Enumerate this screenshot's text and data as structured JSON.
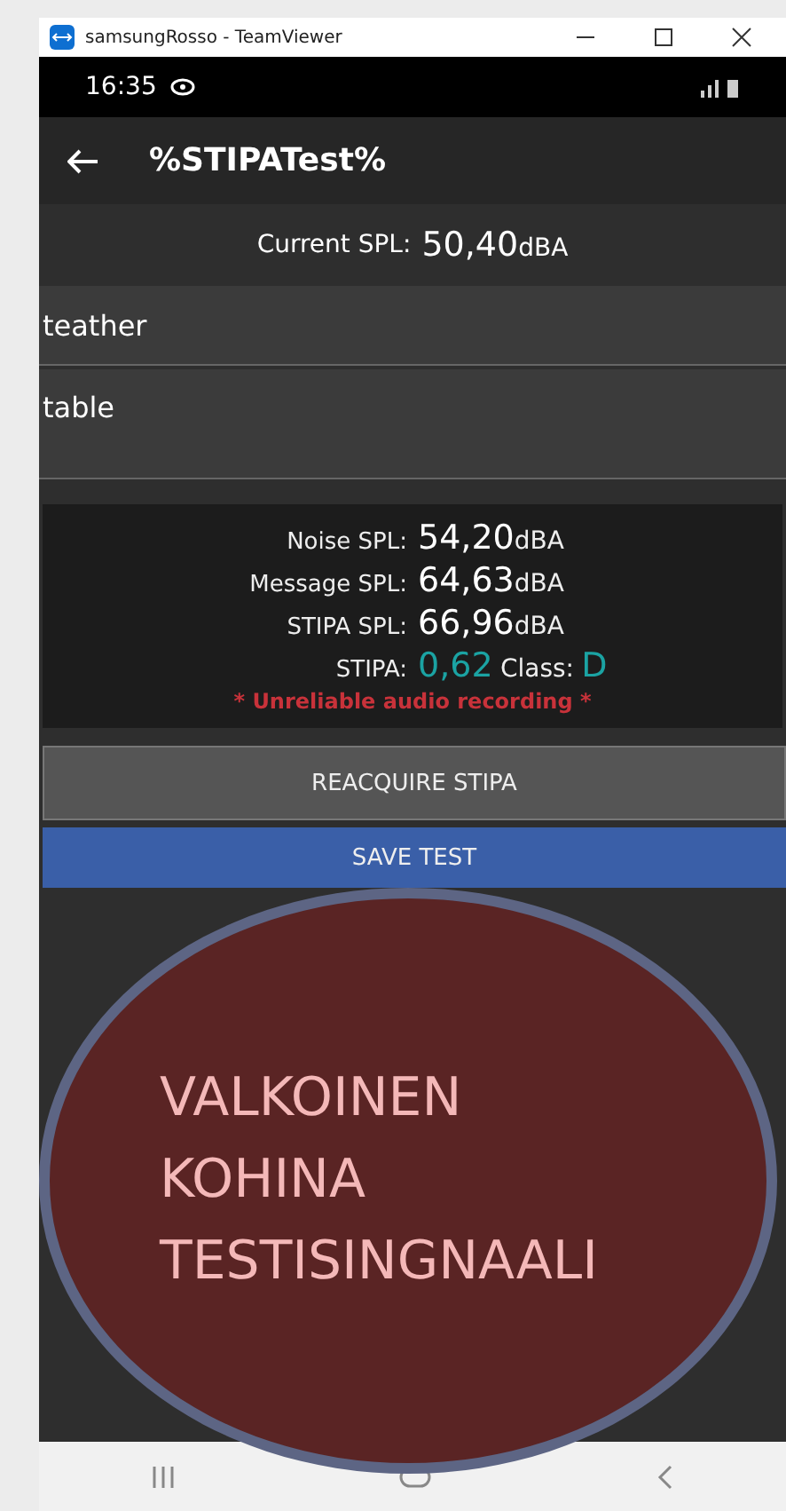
{
  "window": {
    "title": "samsungRosso - TeamViewer"
  },
  "status_bar": {
    "time": "16:35"
  },
  "app_bar": {
    "title": "%STIPATest%"
  },
  "current_spl": {
    "label": "Current SPL:",
    "value": "50,40",
    "unit": "dBA"
  },
  "fields": [
    {
      "value": "teather",
      "kind": "single"
    },
    {
      "value": "table",
      "kind": "multi"
    }
  ],
  "results": [
    {
      "label": "Noise SPL:",
      "value": "54,20",
      "unit": "dBA"
    },
    {
      "label": "Message SPL:",
      "value": "64,63",
      "unit": "dBA"
    },
    {
      "label": "STIPA SPL:",
      "value": "66,96",
      "unit": "dBA"
    }
  ],
  "stipa": {
    "label": "STIPA:",
    "value": "0,62",
    "class_label": "Class:",
    "class_value": "D",
    "color": "#1ba3a3"
  },
  "warning": "* Unreliable audio recording *",
  "buttons": [
    {
      "label": "REACQUIRE STIPA",
      "kind": "secondary"
    },
    {
      "label": "SAVE TEST",
      "kind": "primary"
    }
  ],
  "overlay": {
    "lines": [
      "VALKOINEN",
      "KOHINA",
      "TESTISINGNAALI"
    ]
  }
}
